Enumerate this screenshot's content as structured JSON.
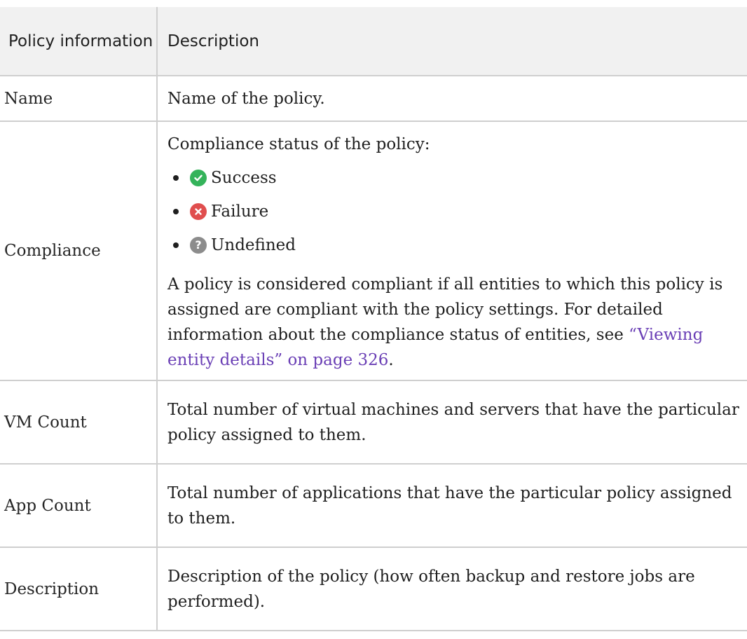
{
  "table": {
    "headers": {
      "col1": "Policy information",
      "col2": "Description"
    },
    "rows": {
      "name": {
        "label": "Name",
        "text": "Name of the policy."
      },
      "compliance": {
        "label": "Compliance",
        "intro": "Compliance status of the policy:",
        "statuses": [
          {
            "icon": "check-circle-icon",
            "color": "#34b35a",
            "label": "Success"
          },
          {
            "icon": "x-circle-icon",
            "color": "#e04e4e",
            "label": "Failure"
          },
          {
            "icon": "question-circle-icon",
            "color": "#8c8c8c",
            "label": "Undefined"
          }
        ],
        "paragraph": "A policy is considered compliant if all entities to which this policy is assigned are compliant with the policy settings. For detailed information about the compliance status of entities, see ",
        "link_text": "“Viewing entity details” on page 326",
        "paragraph_end": "."
      },
      "vm_count": {
        "label": "VM Count",
        "text": "Total number of virtual machines and servers that have the particular policy assigned to them."
      },
      "app_count": {
        "label": "App Count",
        "text": "Total number of applications that have the particular policy assigned to them."
      },
      "description": {
        "label": "Description",
        "text": "Description of the policy (how often backup and restore jobs are performed)."
      }
    }
  },
  "colors": {
    "header_bg": "#f1f1f1",
    "border": "#cfcfcf",
    "link": "#6a3fb5"
  }
}
